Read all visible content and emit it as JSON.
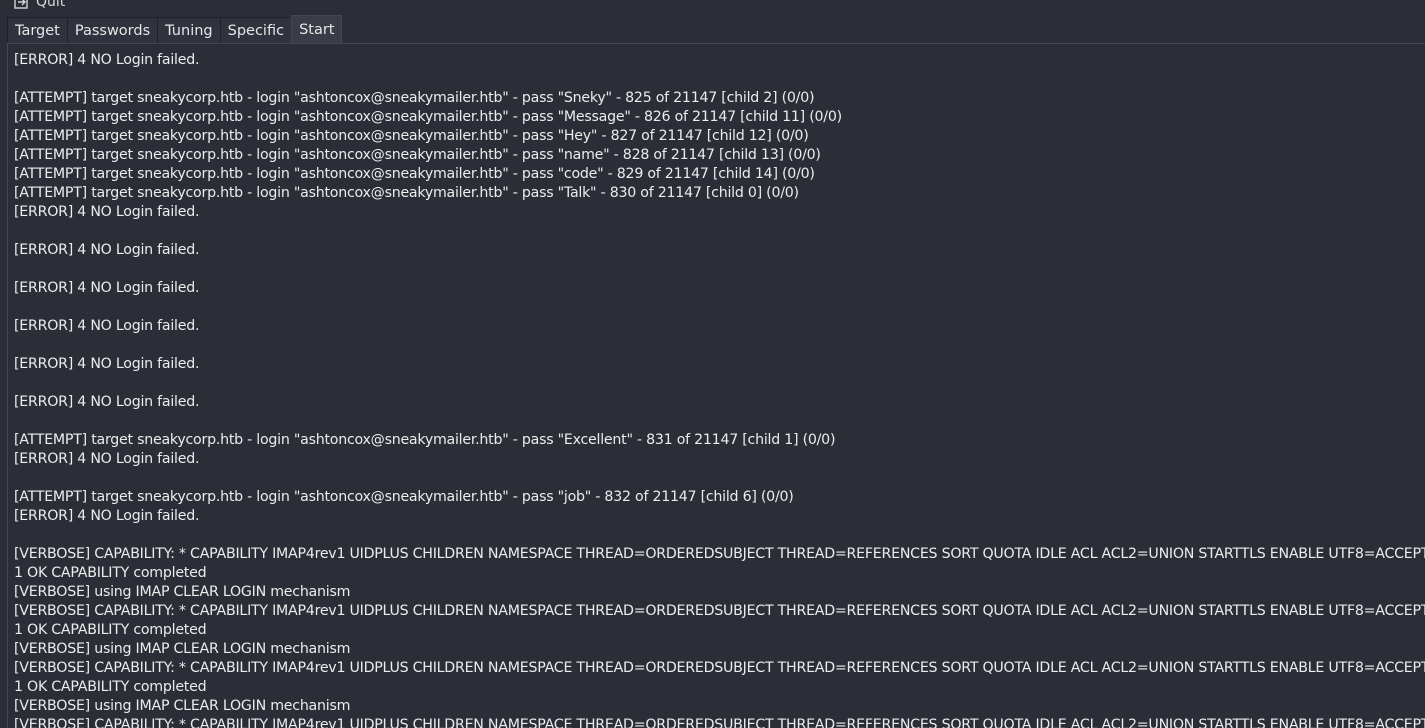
{
  "menu": {
    "quit_label": "Quit",
    "quit_icon": "quit-icon"
  },
  "tabs": [
    {
      "label": "Target",
      "active": false
    },
    {
      "label": "Passwords",
      "active": false
    },
    {
      "label": "Tuning",
      "active": false
    },
    {
      "label": "Specific",
      "active": false
    },
    {
      "label": "Start",
      "active": true
    }
  ],
  "log_lines": [
    "[ERROR] 4 NO Login failed.",
    "",
    "[ATTEMPT] target sneakycorp.htb - login \"ashtoncox@sneakymailer.htb\" - pass \"Sneky\" - 825 of 21147 [child 2] (0/0)",
    "[ATTEMPT] target sneakycorp.htb - login \"ashtoncox@sneakymailer.htb\" - pass \"Message\" - 826 of 21147 [child 11] (0/0)",
    "[ATTEMPT] target sneakycorp.htb - login \"ashtoncox@sneakymailer.htb\" - pass \"Hey\" - 827 of 21147 [child 12] (0/0)",
    "[ATTEMPT] target sneakycorp.htb - login \"ashtoncox@sneakymailer.htb\" - pass \"name\" - 828 of 21147 [child 13] (0/0)",
    "[ATTEMPT] target sneakycorp.htb - login \"ashtoncox@sneakymailer.htb\" - pass \"code\" - 829 of 21147 [child 14] (0/0)",
    "[ATTEMPT] target sneakycorp.htb - login \"ashtoncox@sneakymailer.htb\" - pass \"Talk\" - 830 of 21147 [child 0] (0/0)",
    "[ERROR] 4 NO Login failed.",
    "",
    "[ERROR] 4 NO Login failed.",
    "",
    "[ERROR] 4 NO Login failed.",
    "",
    "[ERROR] 4 NO Login failed.",
    "",
    "[ERROR] 4 NO Login failed.",
    "",
    "[ERROR] 4 NO Login failed.",
    "",
    "[ATTEMPT] target sneakycorp.htb - login \"ashtoncox@sneakymailer.htb\" - pass \"Excellent\" - 831 of 21147 [child 1] (0/0)",
    "[ERROR] 4 NO Login failed.",
    "",
    "[ATTEMPT] target sneakycorp.htb - login \"ashtoncox@sneakymailer.htb\" - pass \"job\" - 832 of 21147 [child 6] (0/0)",
    "[ERROR] 4 NO Login failed.",
    "",
    "[VERBOSE] CAPABILITY: * CAPABILITY IMAP4rev1 UIDPLUS CHILDREN NAMESPACE THREAD=ORDEREDSUBJECT THREAD=REFERENCES SORT QUOTA IDLE ACL ACL2=UNION STARTTLS ENABLE UTF8=ACCEPT",
    "1 OK CAPABILITY completed",
    "[VERBOSE] using IMAP CLEAR LOGIN mechanism",
    "[VERBOSE] CAPABILITY: * CAPABILITY IMAP4rev1 UIDPLUS CHILDREN NAMESPACE THREAD=ORDEREDSUBJECT THREAD=REFERENCES SORT QUOTA IDLE ACL ACL2=UNION STARTTLS ENABLE UTF8=ACCEPT",
    "1 OK CAPABILITY completed",
    "[VERBOSE] using IMAP CLEAR LOGIN mechanism",
    "[VERBOSE] CAPABILITY: * CAPABILITY IMAP4rev1 UIDPLUS CHILDREN NAMESPACE THREAD=ORDEREDSUBJECT THREAD=REFERENCES SORT QUOTA IDLE ACL ACL2=UNION STARTTLS ENABLE UTF8=ACCEPT",
    "1 OK CAPABILITY completed",
    "[VERBOSE] using IMAP CLEAR LOGIN mechanism",
    "[VERBOSE] CAPABILITY: * CAPABILITY IMAP4rev1 UIDPLUS CHILDREN NAMESPACE THREAD=ORDEREDSUBJECT THREAD=REFERENCES SORT QUOTA IDLE ACL ACL2=UNION STARTTLS ENABLE UTF8=ACCEPT"
  ]
}
